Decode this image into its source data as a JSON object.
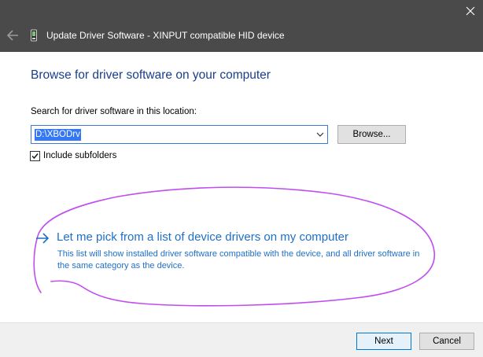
{
  "window": {
    "title": "Update Driver Software - XINPUT compatible HID device"
  },
  "content": {
    "heading": "Browse for driver software on your computer",
    "search_label": "Search for driver software in this location:",
    "path_value": "D:\\XBODrv",
    "browse_label": "Browse...",
    "include_subfolders_label": "Include subfolders",
    "include_subfolders_checked": true,
    "pick_option": {
      "title": "Let me pick from a list of device drivers on my computer",
      "description": "This list will show installed driver software compatible with the device, and all driver software in the same category as the device."
    }
  },
  "footer": {
    "next_label": "Next",
    "cancel_label": "Cancel"
  },
  "icons": {
    "back": "back-arrow-icon",
    "device": "device-icon",
    "close": "close-icon",
    "chevron": "chevron-down-icon",
    "check": "checkmark-icon",
    "link_arrow": "arrow-right-icon"
  },
  "colors": {
    "titlebar": "#4a4a4a",
    "heading": "#1a3e8c",
    "link": "#1f6fc6",
    "selection": "#3478f6",
    "annotation_circle": "#c04df0",
    "footer": "#f0f0f0"
  }
}
